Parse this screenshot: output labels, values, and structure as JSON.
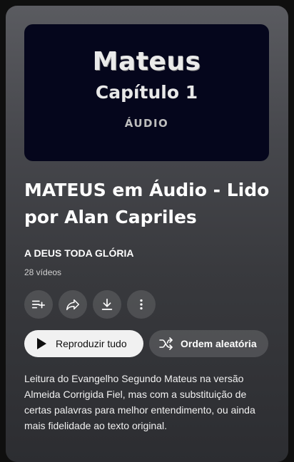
{
  "thumbnail": {
    "title": "Mateus",
    "chapter": "Capítulo 1",
    "label": "ÁUDIO"
  },
  "playlist": {
    "title": "MATEUS em Áudio - Lido por Alan Capriles",
    "channel": "A DEUS TODA GLÓRIA",
    "video_count": "28 vídeos",
    "description": "Leitura do Evangelho Segundo Mateus na versão Almeida Corrigida Fiel, mas com a substituição de certas palavras para melhor entendimento, ou ainda mais fidelidade ao texto original."
  },
  "actions": {
    "icons": [
      "add-to-queue-icon",
      "share-icon",
      "download-icon",
      "more-vert-icon"
    ],
    "play_all": "Reproduzir tudo",
    "shuffle": "Ordem aleatória"
  },
  "colors": {
    "panel_top": "#5a5b60",
    "panel_bottom": "#2c2d31",
    "thumbnail_bg": "#05061c",
    "play_button_bg": "#f1f1f1"
  }
}
